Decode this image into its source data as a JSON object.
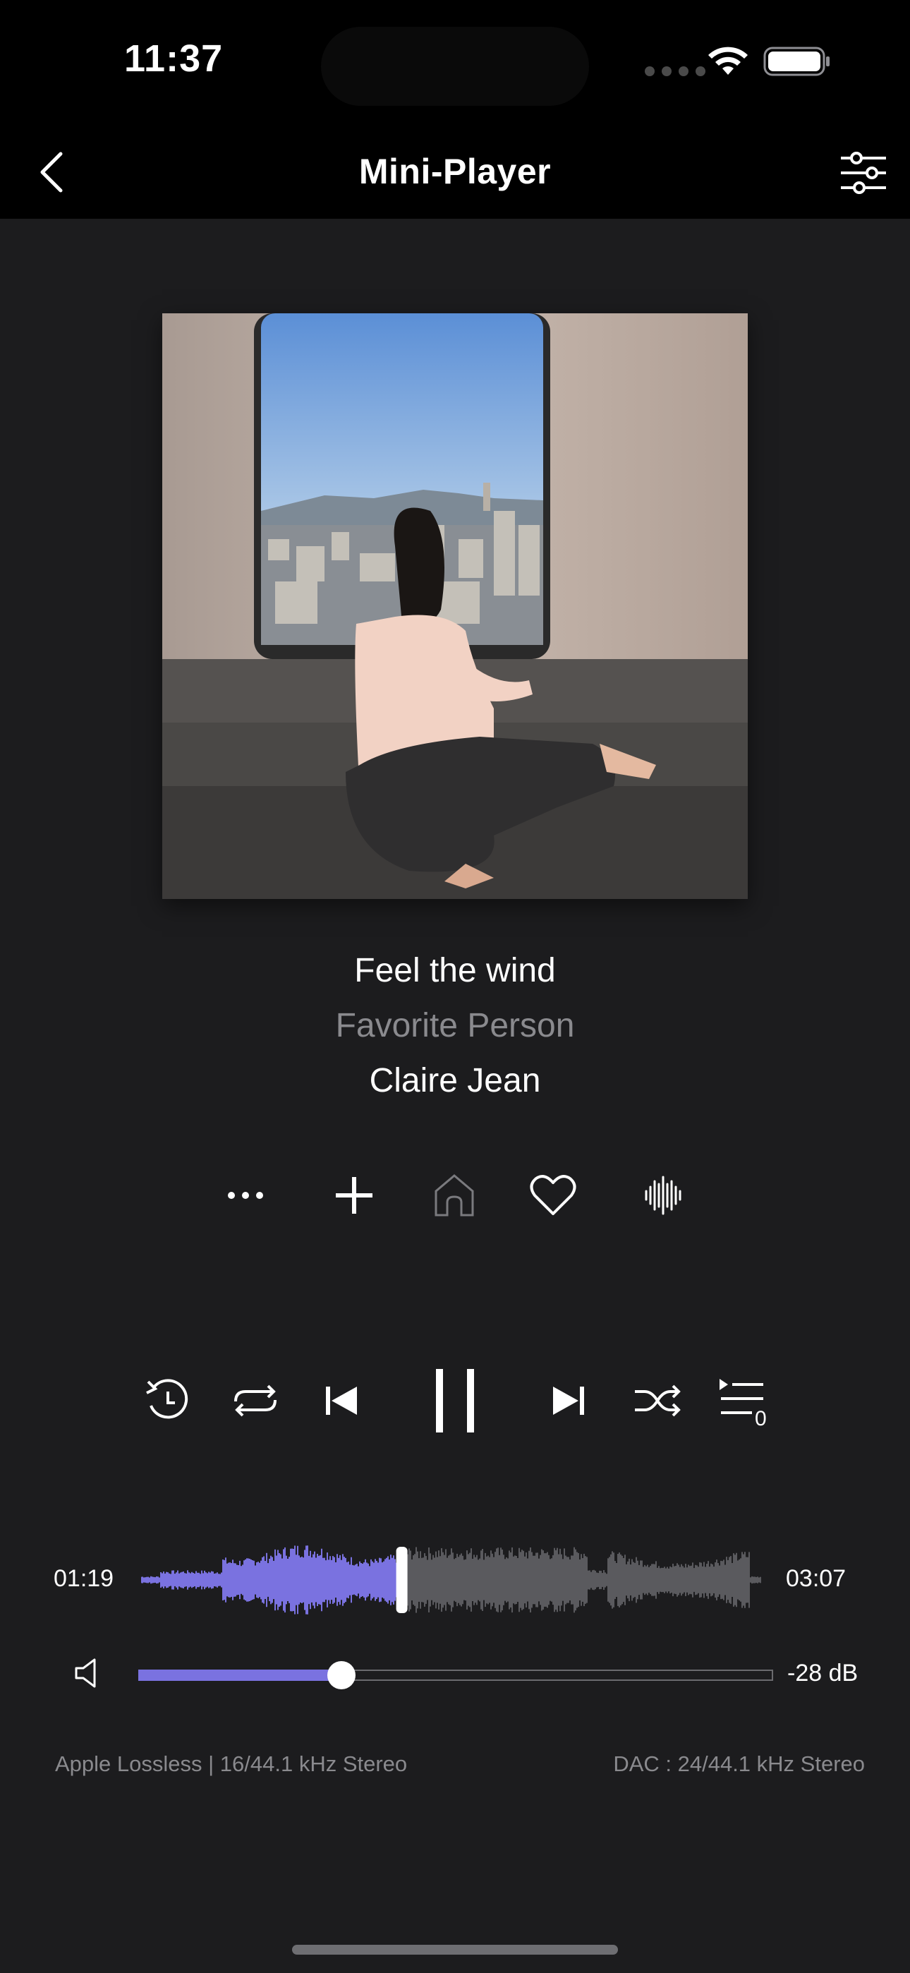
{
  "status_bar": {
    "time": "11:37",
    "icons": [
      "signal-dots-icon",
      "wifi-icon",
      "battery-icon"
    ]
  },
  "nav": {
    "title": "Mini-Player",
    "back_icon": "chevron-left-icon",
    "settings_icon": "sliders-icon"
  },
  "track": {
    "title": "Feel the wind",
    "album": "Favorite Person",
    "artist": "Claire Jean"
  },
  "actions": [
    "more-icon",
    "add-icon",
    "home-icon",
    "heart-icon",
    "waveform-icon"
  ],
  "transport": {
    "buttons": [
      "replay-icon",
      "repeat-icon",
      "previous-icon",
      "pause-icon",
      "next-icon",
      "shuffle-icon",
      "queue-icon"
    ],
    "queue_count": "0"
  },
  "progress": {
    "current": "01:19",
    "total": "03:07",
    "fraction": 0.42
  },
  "volume": {
    "level": 0.32,
    "db": "-28 dB"
  },
  "format": {
    "source": "Apple Lossless | 16/44.1 kHz Stereo",
    "dac": "DAC : 24/44.1 kHz Stereo"
  },
  "colors": {
    "accent": "#7a72e0",
    "background": "#1c1c1e",
    "header": "#000000",
    "muted_text": "#8a8a8e"
  }
}
